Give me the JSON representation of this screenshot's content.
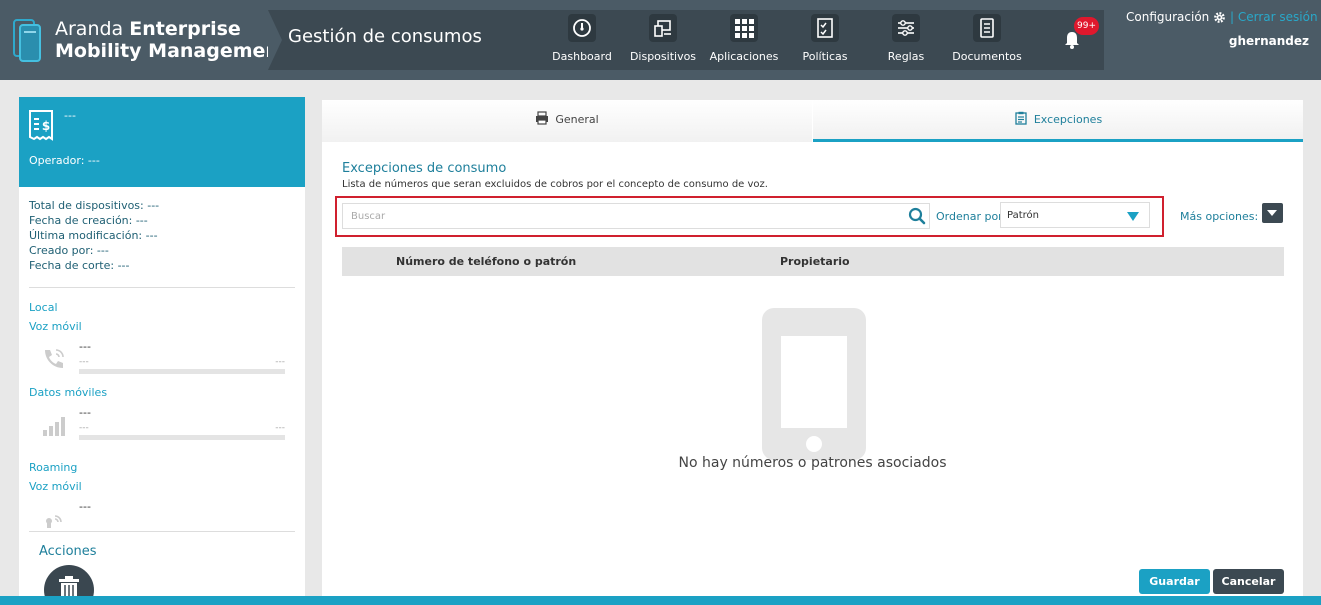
{
  "brand": {
    "line1_light": "Aranda",
    "line1_bold": "Enterprise",
    "line2": "Mobility Management"
  },
  "module_title": "Gestión de consumos",
  "nav": [
    {
      "label": "Dashboard",
      "icon": "dashboard-icon"
    },
    {
      "label": "Dispositivos",
      "icon": "devices-icon"
    },
    {
      "label": "Aplicaciones",
      "icon": "apps-grid-icon"
    },
    {
      "label": "Políticas",
      "icon": "policies-icon"
    },
    {
      "label": "Reglas",
      "icon": "rules-icon"
    },
    {
      "label": "Documentos",
      "icon": "documents-icon"
    }
  ],
  "notifications": {
    "badge": "99+"
  },
  "user": {
    "config_label": "Configuración",
    "separator": "|",
    "logout_label": "Cerrar sesión",
    "username": "ghernandez"
  },
  "left_panel": {
    "name": "---",
    "operator": "Operador: ---",
    "info": [
      "Total de dispositivos:  ---",
      "Fecha de creación:  ---",
      "Última modificación:  ---",
      "Creado por:  ---",
      "Fecha de corte:  ---"
    ],
    "local_label": "Local",
    "local_voice_label": "Voz móvil",
    "local_voice": {
      "value": "---",
      "left": "---",
      "right": "---"
    },
    "data_label": "Datos móviles",
    "data_usage": {
      "value": "---",
      "left": "---",
      "right": "---"
    },
    "roaming_label": "Roaming",
    "roaming_voice_label": "Voz móvil",
    "roaming_voice": {
      "value": "---"
    },
    "actions_title": "Acciones"
  },
  "tabs": [
    {
      "label": "General",
      "icon": "printer-icon",
      "active": false
    },
    {
      "label": "Excepciones",
      "icon": "clipboard-icon",
      "active": true
    }
  ],
  "exceptions": {
    "title": "Excepciones de consumo",
    "description": "Lista de números que seran excluidos de cobros por el concepto de consumo de voz.",
    "search_placeholder": "Buscar",
    "sort_label": "Ordenar por",
    "sort_value": "Patrón",
    "more_options_label": "Más opciones:",
    "columns": [
      "Número de teléfono o patrón",
      "Propietario"
    ],
    "empty_message": "No hay números o patrones asociados"
  },
  "buttons": {
    "save": "Guardar",
    "cancel": "Cancelar"
  },
  "colors": {
    "topbar": "#4b5b66",
    "accent": "#1ba1c4",
    "dark": "#3c4952",
    "highlight": "#d0202e",
    "badge": "#e0182d"
  }
}
